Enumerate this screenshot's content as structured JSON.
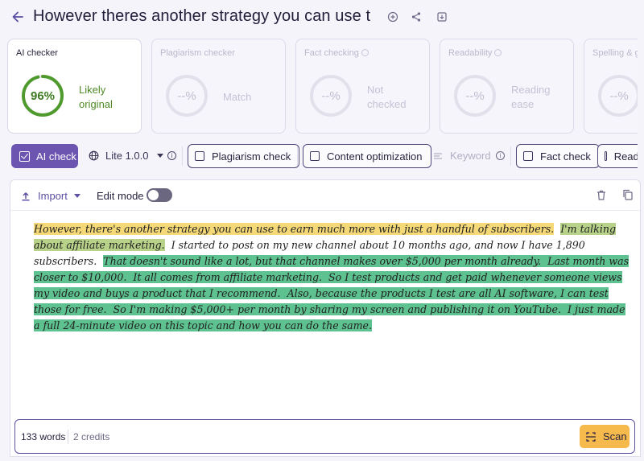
{
  "header": {
    "title": "However theres another strategy you can use to e"
  },
  "cards": [
    {
      "label": "AI checker",
      "value": "96%",
      "status": "Likely original",
      "active": true,
      "color": "#4f9a2c"
    },
    {
      "label": "Plagiarism checker",
      "value": "--%",
      "status": "Match"
    },
    {
      "label": "Fact checking",
      "value": "--%",
      "status": "Not checked"
    },
    {
      "label": "Readability",
      "value": "--%",
      "status": "Reading ease"
    },
    {
      "label": "Spelling & gra",
      "value": "--%",
      "status": ""
    }
  ],
  "ai_score_fraction": 0.96,
  "toolbar": {
    "ai_check": "AI check",
    "model": "Lite 1.0.0",
    "plagiarism": "Plagiarism check",
    "content_opt": "Content optimization",
    "keyword": "Keyword",
    "fact_check": "Fact check",
    "readability": "Reada"
  },
  "editor": {
    "import": "Import",
    "edit_mode": "Edit mode",
    "edit_mode_on": false,
    "segments": [
      {
        "text": "However, there's another strategy you can use to earn much more with just a handful of subscribers.",
        "level": "y"
      },
      {
        "text": "I'm talking about affiliate marketing.",
        "level": "l"
      },
      {
        "text": "I started to post on my new channel about 10 months ago, and now I have 1,890 subscribers.",
        "level": "none"
      },
      {
        "text": "That doesn't sound like a lot, but that channel makes over $5,000 per month already.",
        "level": "g"
      },
      {
        "text": "Last month was closer to $10,000.",
        "level": "g"
      },
      {
        "text": "It all comes from affiliate marketing.",
        "level": "g"
      },
      {
        "text": "So I test products and get paid whenever someone views my video and buys a product that I recommend.",
        "level": "g"
      },
      {
        "text": "Also, because the products I test are all AI software, I can test those for free.",
        "level": "g"
      },
      {
        "text": "So I'm making $5,000+ per month by sharing my screen and publishing it on YouTube.",
        "level": "g"
      },
      {
        "text": "I just made a full 24-minute video on this topic and how you can do the same.",
        "level": "g"
      }
    ]
  },
  "footer": {
    "words": "133 words",
    "credits": "2 credits",
    "scan": "Scan"
  },
  "colors": {
    "accent": "#6c55b0",
    "highlight_yellow": "#f5d978",
    "highlight_lightgreen": "#b8d28a",
    "highlight_green": "#5ec290",
    "scan": "#f6b94c"
  }
}
